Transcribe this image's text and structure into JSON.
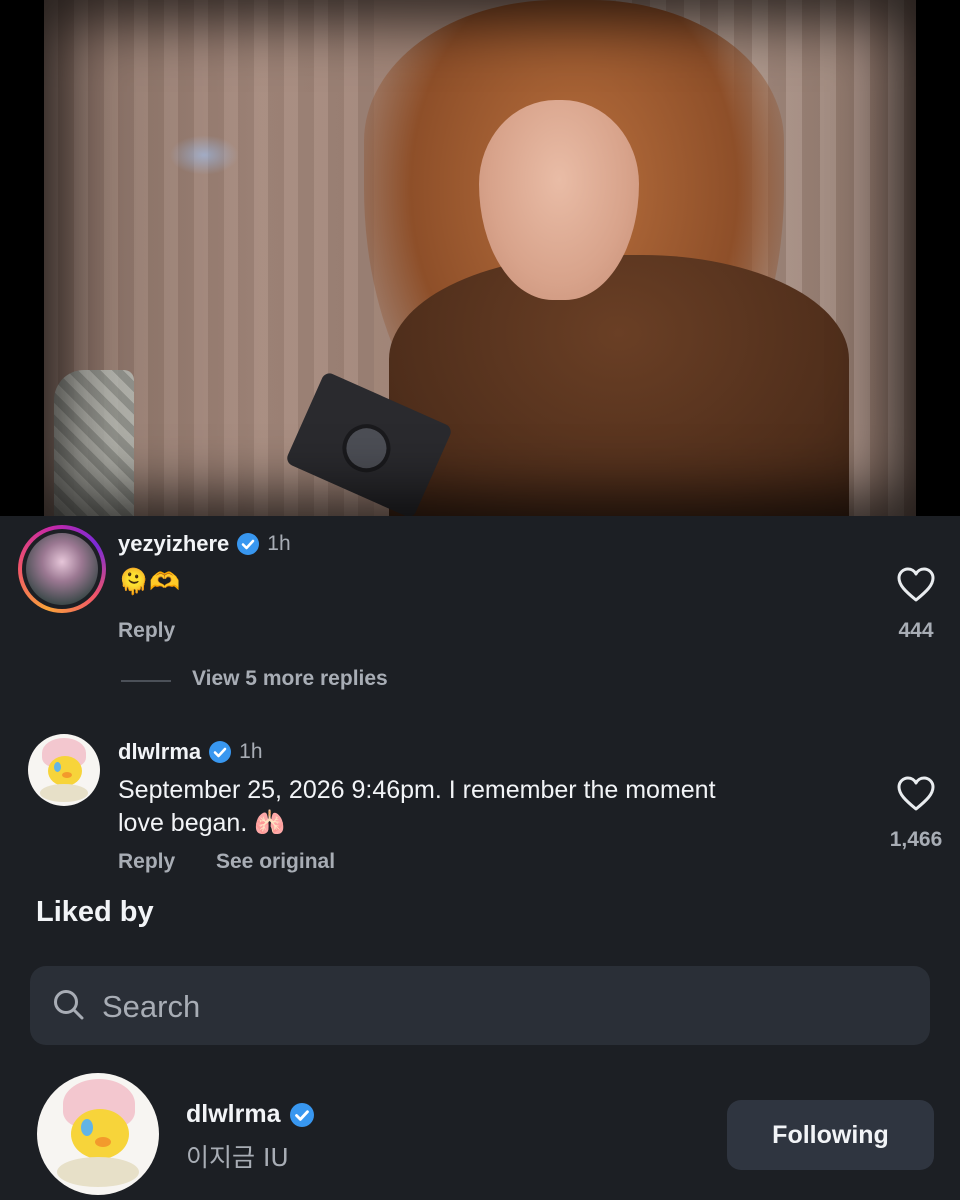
{
  "post_media": {
    "description_icon": "photo"
  },
  "comments": [
    {
      "username": "yezyizhere",
      "time": "1h",
      "text": "🫠🫶",
      "reply_label": "Reply",
      "likes": "444",
      "view_more": "View 5 more replies"
    },
    {
      "username": "dlwlrma",
      "time": "1h",
      "text_line1": "September 25, 2026 9:46pm. I remember the moment",
      "text_line2": "love began. 🫁",
      "reply_label": "Reply",
      "see_original_label": "See original",
      "likes": "1,466"
    }
  ],
  "liked_by": {
    "title": "Liked by",
    "search_placeholder": "Search",
    "users": [
      {
        "username": "dlwlrma",
        "full_name": "이지금 IU",
        "button_label": "Following"
      }
    ]
  },
  "colors": {
    "background": "#1c1f24",
    "verified": "#3897f0",
    "muted_text": "#a8adb5",
    "search_bg": "#2a2f37",
    "button_bg": "#2f3540"
  }
}
